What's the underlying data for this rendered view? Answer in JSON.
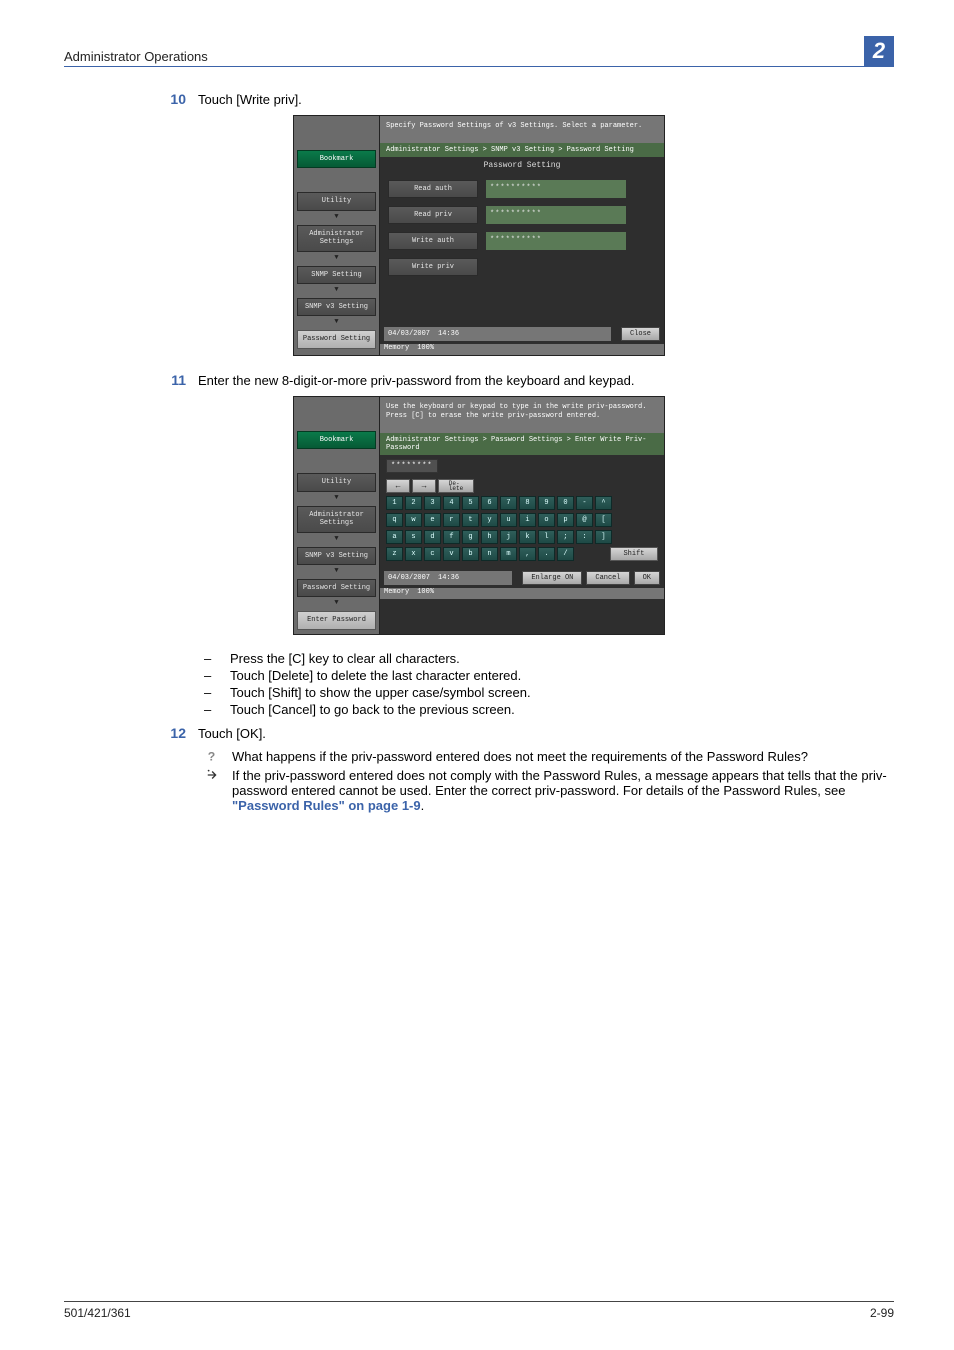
{
  "header": {
    "title": "Administrator Operations",
    "chapter": "2"
  },
  "steps": {
    "s10": {
      "num": "10",
      "text": "Touch [Write priv]."
    },
    "s11": {
      "num": "11",
      "text": "Enter the new 8-digit-or-more priv-password from the keyboard and keypad."
    },
    "s12": {
      "num": "12",
      "text": "Touch [OK]."
    }
  },
  "bullets": {
    "b1": "Press the [C] key to clear all characters.",
    "b2": "Touch [Delete] to delete the last character entered.",
    "b3": "Touch [Shift] to show the upper case/symbol screen.",
    "b4": "Touch [Cancel] to go back to the previous screen."
  },
  "qa": {
    "q": "What happens if the priv-password entered does not meet the requirements of the Password Rules?",
    "a_pre": "If the priv-password entered does not comply with the Password Rules, a message appears that tells that the priv-password entered cannot be used. Enter the correct priv-password. For details of the Password Rules, see ",
    "a_link": "\"Password Rules\" on page 1-9",
    "a_post": "."
  },
  "panel1": {
    "topmsg": "Specify Password Settings of v3 Settings. Select a parameter.",
    "crumb": "Administrator Settings > SNMP v3 Setting > Password Setting",
    "subhead": "Password Setting",
    "side": {
      "bookmark": "Bookmark",
      "utility": "Utility",
      "admin": "Administrator Settings",
      "snmp": "SNMP Setting",
      "snmpv3": "SNMP v3 Setting",
      "pwd": "Password Setting"
    },
    "rows": {
      "r1": {
        "label": "Read auth",
        "val": "**********"
      },
      "r2": {
        "label": "Read priv",
        "val": "**********"
      },
      "r3": {
        "label": "Write auth",
        "val": "**********"
      },
      "r4": {
        "label": "Write priv",
        "val": ""
      }
    },
    "status": {
      "date": "04/03/2007",
      "time": "14:36",
      "memlabel": "Memory",
      "mem": "100%"
    },
    "close": "Close"
  },
  "panel2": {
    "topmsg": "Use the keyboard or keypad to type in the write priv-password.\nPress [C] to erase the write priv-password entered.",
    "crumb": "Administrator Settings > Password Settings > Enter Write Priv-Password",
    "input": "********",
    "side": {
      "bookmark": "Bookmark",
      "utility": "Utility",
      "admin": "Administrator Settings",
      "snmpv3": "SNMP v3 Setting",
      "pwd": "Password Setting",
      "enter": "Enter Password"
    },
    "nav": {
      "left": "←",
      "right": "→",
      "del": "De-\nlete"
    },
    "kb": {
      "row1": [
        "1",
        "2",
        "3",
        "4",
        "5",
        "6",
        "7",
        "8",
        "9",
        "0",
        "-",
        "^"
      ],
      "row2": [
        "q",
        "w",
        "e",
        "r",
        "t",
        "y",
        "u",
        "i",
        "o",
        "p",
        "@",
        "["
      ],
      "row3": [
        "a",
        "s",
        "d",
        "f",
        "g",
        "h",
        "j",
        "k",
        "l",
        ";",
        ":",
        "]"
      ],
      "row4": [
        "z",
        "x",
        "c",
        "v",
        "b",
        "n",
        "m",
        ",",
        ".",
        "/"
      ],
      "shift": "Shift"
    },
    "status": {
      "date": "04/03/2007",
      "time": "14:36",
      "memlabel": "Memory",
      "mem": "100%"
    },
    "enlarge": "Enlarge ON",
    "cancel": "Cancel",
    "ok": "OK"
  },
  "footer": {
    "left": "501/421/361",
    "right": "2-99"
  }
}
